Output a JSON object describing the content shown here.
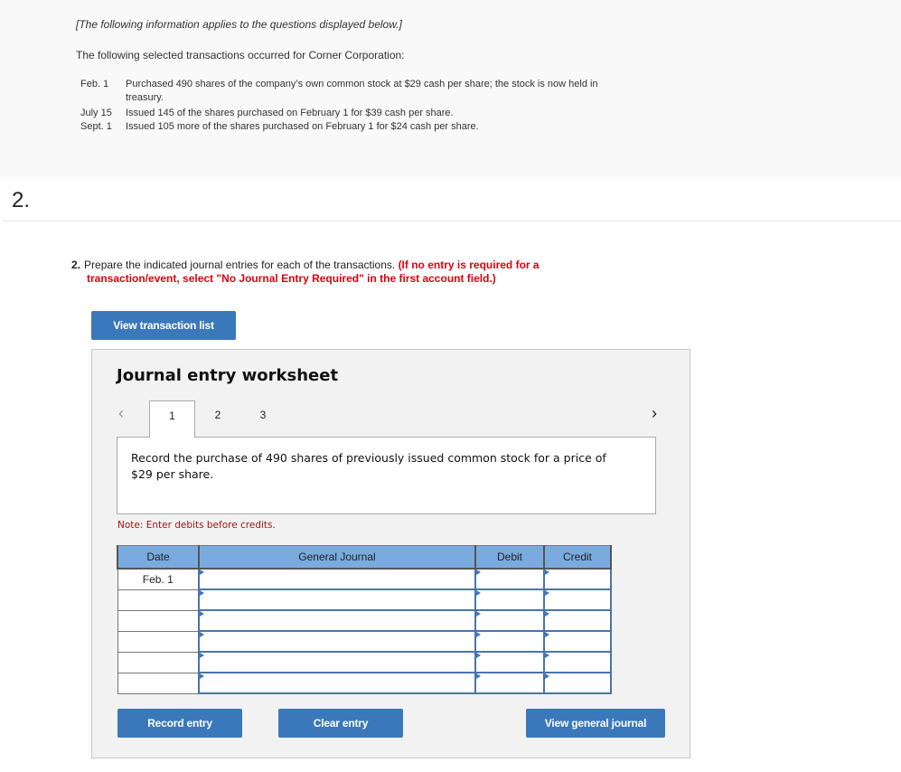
{
  "info": {
    "intro": "[The following information applies to the questions displayed below.]",
    "lead": "The following selected transactions occurred for Corner Corporation:",
    "transactions": [
      {
        "date": "Feb. 1",
        "text": "Purchased 490 shares of the company’s own common stock at $29 cash per share; the stock is now held in treasury."
      },
      {
        "date": "July 15",
        "text": "Issued 145 of the shares purchased on February 1 for $39 cash per share."
      },
      {
        "date": "Sept. 1",
        "text": "Issued 105 more of the shares purchased on February 1 for $24 cash per share."
      }
    ]
  },
  "question": {
    "number": "2.",
    "prompt_number": "2.",
    "prompt_text": "Prepare the indicated journal entries for each of the transactions.",
    "prompt_red_1": "(If no entry is required for a",
    "prompt_red_2": "transaction/event, select \"No Journal Entry Required\" in the first account field.)"
  },
  "buttons": {
    "view_transaction_list": "View transaction list",
    "record_entry": "Record entry",
    "clear_entry": "Clear entry",
    "view_general_journal": "View general journal"
  },
  "worksheet": {
    "title": "Journal entry worksheet",
    "prev_icon": "‹",
    "next_icon": "›",
    "tabs": [
      "1",
      "2",
      "3"
    ],
    "active_tab": "1",
    "description": "Record the purchase of 490 shares of previously issued common stock for a price of $29 per share.",
    "note": "Note: Enter debits before credits.",
    "columns": [
      "Date",
      "General Journal",
      "Debit",
      "Credit"
    ],
    "rows": [
      {
        "date": "Feb. 1",
        "account": "",
        "debit": "",
        "credit": ""
      },
      {
        "date": "",
        "account": "",
        "debit": "",
        "credit": ""
      },
      {
        "date": "",
        "account": "",
        "debit": "",
        "credit": ""
      },
      {
        "date": "",
        "account": "",
        "debit": "",
        "credit": ""
      },
      {
        "date": "",
        "account": "",
        "debit": "",
        "credit": ""
      },
      {
        "date": "",
        "account": "",
        "debit": "",
        "credit": ""
      }
    ]
  },
  "colors": {
    "button_blue": "#3b78bb",
    "header_blue": "#7aabe0",
    "red_instruction": "#e0000f",
    "note_red": "#a01616"
  }
}
